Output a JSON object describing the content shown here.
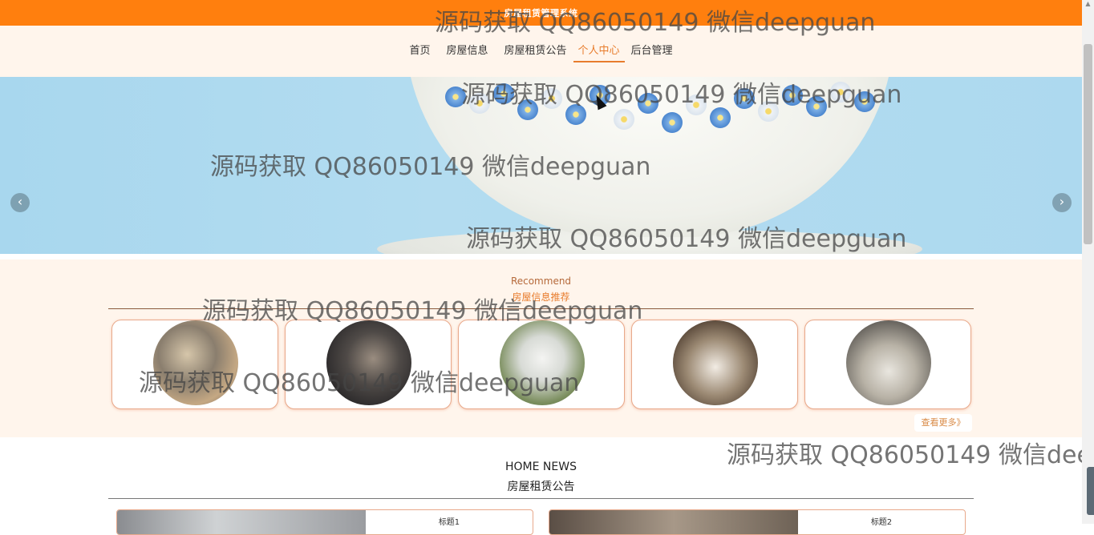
{
  "header": {
    "title": "房屋租赁管理系统"
  },
  "nav": {
    "items": [
      {
        "label": "首页",
        "active": false
      },
      {
        "label": "房屋信息",
        "active": false
      },
      {
        "label": "房屋租赁公告",
        "active": false
      },
      {
        "label": "个人中心",
        "active": true
      },
      {
        "label": "后台管理",
        "active": false
      }
    ],
    "accent_color": "#e87c2c"
  },
  "banner": {
    "prev_icon": "chevron-left-icon",
    "next_icon": "chevron-right-icon",
    "prev_label": "‹",
    "next_label": "›"
  },
  "recommend": {
    "title_en": "Recommend",
    "title_cn": "房屋信息推荐",
    "more_label": "查看更多》",
    "cards_count": 5
  },
  "news": {
    "title_en": "HOME NEWS",
    "title_cn": "房屋租赁公告",
    "items": [
      {
        "title": "标题1"
      },
      {
        "title": "标题2"
      }
    ]
  },
  "watermark": {
    "text": "源码获取 QQ86050149 微信deepguan"
  },
  "colors": {
    "topbar": "#ff7f0e",
    "section_bg": "#fff5ec"
  }
}
